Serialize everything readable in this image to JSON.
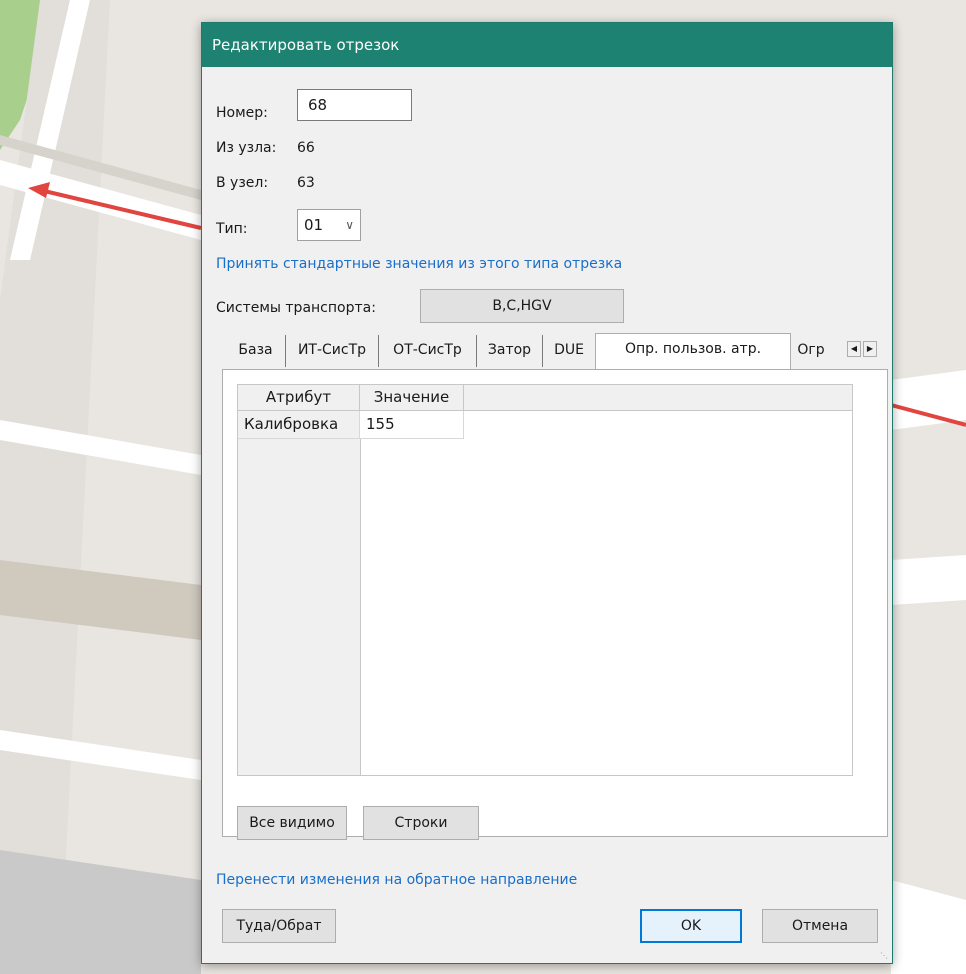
{
  "window": {
    "title": "Редактировать отрезок"
  },
  "fields": {
    "number_label": "Номер:",
    "number_value": "68",
    "from_node_label": "Из узла:",
    "from_node_value": "66",
    "to_node_label": "В узел:",
    "to_node_value": "63",
    "type_label": "Тип:",
    "type_value": "01",
    "apply_defaults_link": "Принять стандартные значения из этого типа отрезка",
    "transport_systems_label": "Системы транспорта:",
    "transport_systems_value": "B,C,HGV"
  },
  "tabs": [
    {
      "label": "База"
    },
    {
      "label": "ИТ-СисТр"
    },
    {
      "label": "ОТ-СисТр"
    },
    {
      "label": "Затор"
    },
    {
      "label": "DUE"
    },
    {
      "label": "Опр. пользов. атр.",
      "active": true
    },
    {
      "label": "Огр"
    }
  ],
  "grid": {
    "columns": [
      "Атрибут",
      "Значение"
    ],
    "rows": [
      {
        "attribute": "Калибровка",
        "value": "155"
      }
    ]
  },
  "panel_buttons": {
    "all_visible": "Все видимо",
    "rows": "Строки"
  },
  "footer": {
    "transfer_link": "Перенести изменения на обратное направление",
    "there_back_button": "Туда/Обрат",
    "ok_button": "OK",
    "cancel_button": "Отмена"
  },
  "colors": {
    "titlebar": "#1e8272",
    "link": "#1a6fc9",
    "map_route": "#e0453f"
  }
}
